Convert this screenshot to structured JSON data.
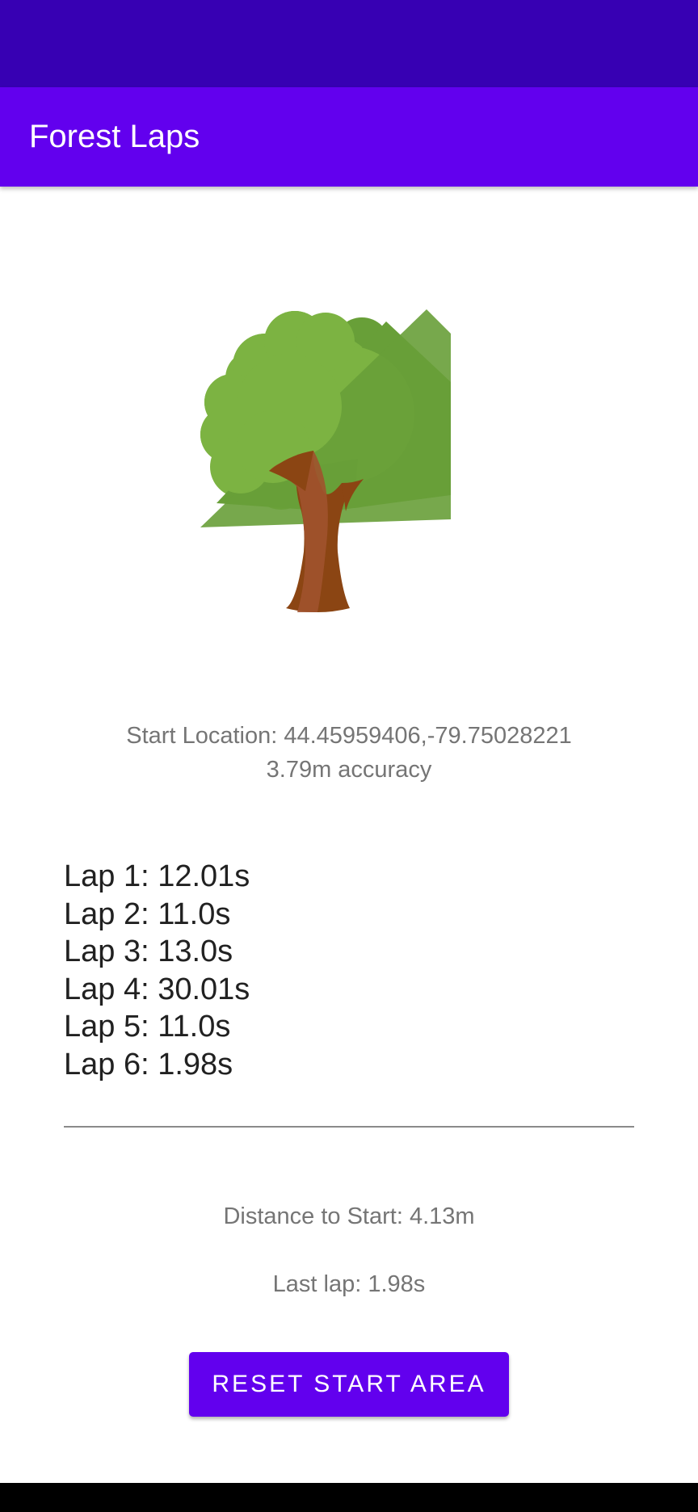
{
  "app": {
    "title": "Forest Laps"
  },
  "colors": {
    "status_bar": "#3700b3",
    "primary": "#6200ee",
    "secondary_text": "#757575",
    "primary_text": "#212121",
    "tree_leaf_light": "#7cb342",
    "tree_leaf_dark": "#689f38",
    "tree_trunk": "#8b4513"
  },
  "image": {
    "icon": "tree-icon"
  },
  "location": {
    "start_line": "Start Location: 44.45959406,-79.75028221",
    "accuracy_line": "3.79m accuracy"
  },
  "laps": [
    "Lap 1: 12.01s",
    "Lap 2: 11.0s",
    "Lap 3: 13.0s",
    "Lap 4: 30.01s",
    "Lap 5: 11.0s",
    "Lap 6: 1.98s"
  ],
  "status": {
    "distance": "Distance to Start: 4.13m",
    "last_lap": "Last lap: 1.98s"
  },
  "actions": {
    "reset_label": "RESET START AREA"
  }
}
